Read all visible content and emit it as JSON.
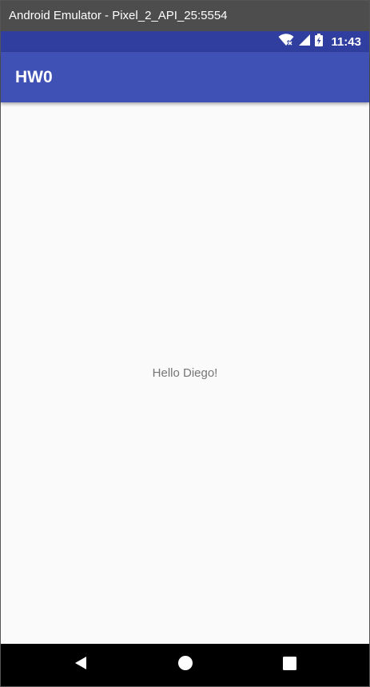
{
  "window": {
    "title": "Android Emulator - Pixel_2_API_25:5554"
  },
  "status_bar": {
    "time": "11:43",
    "icons": [
      "wifi-icon",
      "signal-icon",
      "battery-charging-icon"
    ],
    "background": "#303f9f"
  },
  "app_bar": {
    "title": "HW0",
    "background": "#3f51b5"
  },
  "main": {
    "greeting": "Hello Diego!"
  },
  "nav_bar": {
    "buttons": [
      "back-icon",
      "home-icon",
      "recents-icon"
    ]
  }
}
